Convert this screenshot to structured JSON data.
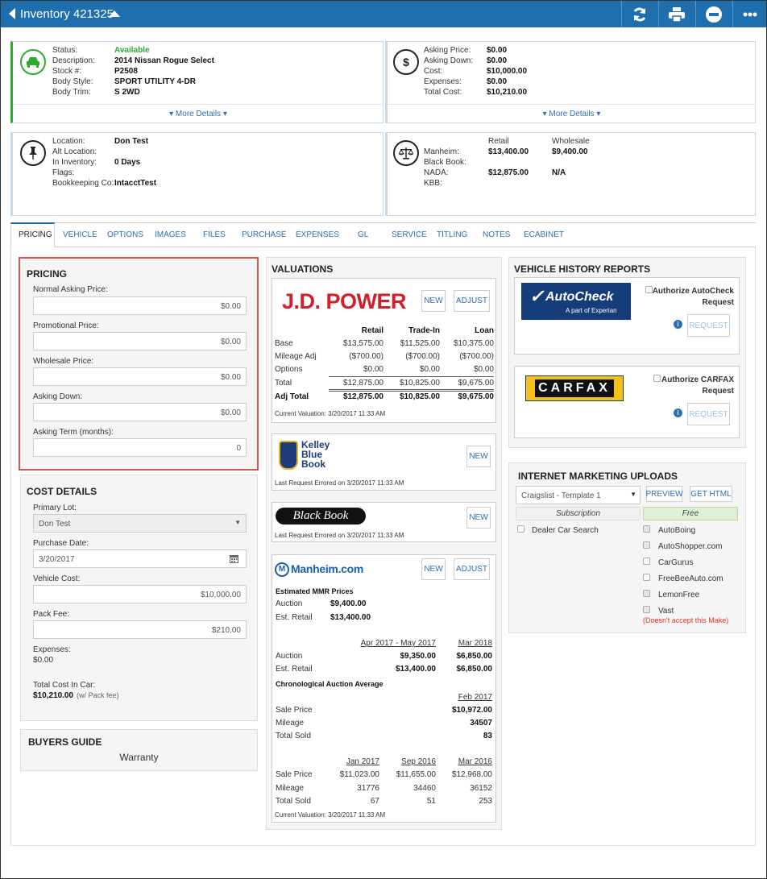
{
  "header": {
    "title": "Inventory 421325"
  },
  "summary": {
    "status_label": "Status:",
    "status": "Available",
    "desc_label": "Description:",
    "description": "2014 Nissan Rogue Select",
    "stock_label": "Stock #:",
    "stock": "P2508",
    "body_label": "Body Style:",
    "body_style": "SPORT UTILITY 4-DR",
    "trim_label": "Body Trim:",
    "trim": "S 2WD",
    "more": "More Details",
    "asking_label": "Asking Price:",
    "asking": "$0.00",
    "down_label": "Asking Down:",
    "down": "$0.00",
    "cost_label": "Cost:",
    "cost": "$10,000.00",
    "exp_label": "Expenses:",
    "expenses": "$0.00",
    "total_label": "Total Cost:",
    "total": "$10,210.00",
    "more2": "More Details",
    "loc_label": "Location:",
    "location": "Don Test",
    "alt_label": "Alt Location:",
    "inv_label": "In Inventory:",
    "inventory": "0 Days",
    "flags_label": "Flags:",
    "book_label": "Bookkeeping Co:",
    "bookkeeping": "IntacctTest",
    "retail_h": "Retail",
    "wholesale_h": "Wholesale",
    "manheim_label": "Manheim:",
    "manheim_retail": "$13,400.00",
    "manheim_wholesale": "$9,400.00",
    "bb_label": "Black Book:",
    "nada_label": "NADA:",
    "nada_retail": "$12,875.00",
    "nada_wholesale": "N/A",
    "kbb_label": "KBB:"
  },
  "tabs": [
    "PRICING",
    "VEHICLE",
    "OPTIONS",
    "IMAGES",
    "FILES",
    "PURCHASE",
    "EXPENSES",
    "GL",
    "SERVICE",
    "TITLING",
    "NOTES",
    "ECABINET"
  ],
  "pricing": {
    "title": "PRICING",
    "normal_label": "Normal Asking Price:",
    "normal": "$0.00",
    "promo_label": "Promotional Price:",
    "promo": "$0.00",
    "wholesale_label": "Wholesale Price:",
    "wholesale": "$0.00",
    "down_label": "Asking Down:",
    "down": "$0.00",
    "term_label": "Asking Term (months):",
    "term": "0"
  },
  "cost": {
    "title": "COST DETAILS",
    "lot_label": "Primary Lot:",
    "lot": "Don Test",
    "date_label": "Purchase Date:",
    "date": "3/20/2017",
    "vcost_label": "Vehicle Cost:",
    "vcost": "$10,000.00",
    "pack_label": "Pack Fee:",
    "pack": "$210.00",
    "exp_label": "Expenses:",
    "exp": "$0.00",
    "tc_label": "Total Cost In Car:",
    "tc": "$10,210.00",
    "tc_note": "(w/ Pack fee)"
  },
  "buyers": {
    "title": "BUYERS GUIDE",
    "warranty": "Warranty"
  },
  "valuations": {
    "title": "VALUATIONS",
    "jd": {
      "logo": "J.D. POWER",
      "new": "NEW",
      "adjust": "ADJUST",
      "cols": [
        "Retail",
        "Trade-In",
        "Loan"
      ],
      "rows": [
        {
          "label": "Base",
          "v": [
            "$13,575.00",
            "$11,525.00",
            "$10,375.00"
          ]
        },
        {
          "label": "Mileage Adj",
          "v": [
            "($700.00)",
            "($700.00)",
            "($700.00)"
          ]
        },
        {
          "label": "Options",
          "v": [
            "$0.00",
            "$0.00",
            "$0.00"
          ]
        },
        {
          "label": "Total",
          "v": [
            "$12,875.00",
            "$10,825.00",
            "$9,675.00"
          ]
        },
        {
          "label": "Adj Total",
          "v": [
            "$12,875.00",
            "$10,825.00",
            "$9,675.00"
          ]
        }
      ],
      "current": "Current Valuation: 3/20/2017 11:33 AM"
    },
    "kbb": {
      "l1": "Kelley",
      "l2": "Blue",
      "l3": "Book",
      "new": "NEW",
      "note": "Last Request Errored on 3/20/2017 11:33 AM"
    },
    "bb": {
      "logo": "Black Book",
      "new": "NEW",
      "note": "Last Request Errored on 3/20/2017 11:33 AM"
    },
    "manheim": {
      "logo": "Manheim.com",
      "new": "NEW",
      "adjust": "ADJUST",
      "est_title": "Estimated MMR Prices",
      "auction_label": "Auction",
      "auction": "$9,400.00",
      "retail_label": "Est. Retail",
      "retail": "$13,400.00",
      "p1": "Apr 2017 - May 2017",
      "p2": "Mar 2018",
      "a1": "$9,350.00",
      "a2": "$6,850.00",
      "r1": "$13,400.00",
      "r2": "$6,850.00",
      "chrono": "Chronological Auction Average",
      "feb": "Feb 2017",
      "sale_label": "Sale Price",
      "mileage_label": "Mileage",
      "sold_label": "Total Sold",
      "feb_sale": "$10,972.00",
      "feb_mileage": "34507",
      "feb_sold": "83",
      "c1": "Jan 2017",
      "c2": "Sep 2016",
      "c3": "Mar 2016",
      "s1": "$11,023.00",
      "s2": "$11,655.00",
      "s3": "$12,968.00",
      "m1": "31776",
      "m2": "34460",
      "m3": "36152",
      "t1": "67",
      "t2": "51",
      "t3": "253",
      "current": "Current Valuation: 3/20/2017 11:33 AM"
    }
  },
  "history": {
    "title": "VEHICLE HISTORY REPORTS",
    "autocheck_logo": "AutoCheck",
    "autocheck_sub": "A part of Experian",
    "ac_auth": "Authorize AutoCheck",
    "ac_req": "Request",
    "ac_btn": "REQUEST",
    "carfax_logo": "CARFAX",
    "cf_auth": "Authorize CARFAX",
    "cf_req": "Request",
    "cf_btn": "REQUEST"
  },
  "imu": {
    "title": "INTERNET MARKETING UPLOADS",
    "template": "Craigslist - Template 1",
    "preview": "PREVIEW",
    "get_html": "GET HTML",
    "subscription": "Subscription",
    "free": "Free",
    "dealer": "Dealer Car Search",
    "sites": [
      "AutoBoing",
      "AutoShopper.com",
      "CarGurus",
      "FreeBeeAuto.com",
      "LemonFree",
      "Vast"
    ],
    "vast_note": "(Doesn't accept this Make)"
  },
  "colors": {
    "accent": "#1f6fae",
    "available": "#2eaa2e",
    "highlight": "#d9534f"
  }
}
